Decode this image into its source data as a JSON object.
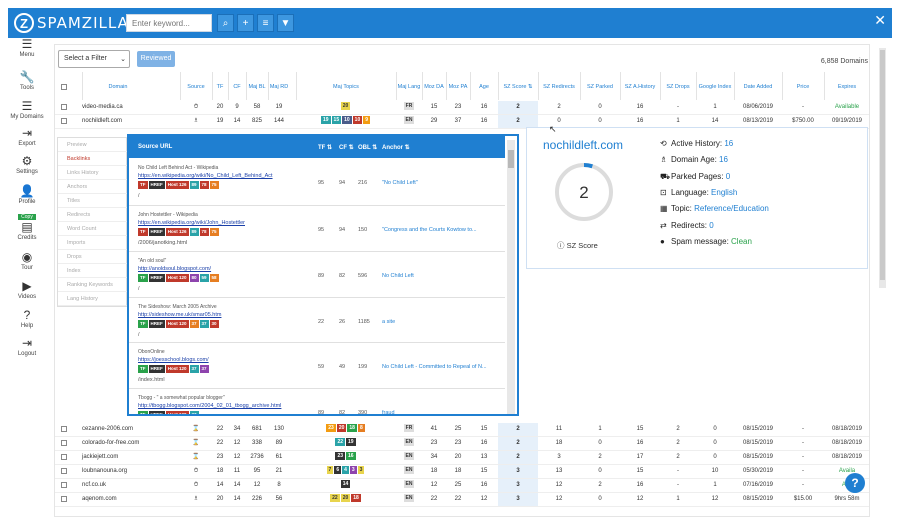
{
  "app": {
    "logo_letter": "Z",
    "logo_text": "SPAMZILLA"
  },
  "search": {
    "placeholder": "Enter keyword..."
  },
  "toolbar": {
    "search_icon": "search-icon",
    "add_icon": "plus-icon",
    "list_icon": "list-icon",
    "filter_icon": "filter-icon",
    "close": "✕"
  },
  "sidebar": [
    {
      "label": "Menu",
      "icon": "☰"
    },
    {
      "label": "Tools",
      "icon": "🔧"
    },
    {
      "label": "My Domains",
      "icon": "☰"
    },
    {
      "label": "Export",
      "icon": "⇥"
    },
    {
      "label": "Settings",
      "icon": "⚙"
    },
    {
      "label": "Profile",
      "icon": "👤"
    },
    {
      "label": "Credits",
      "icon": "▤",
      "badge": "Copy"
    },
    {
      "label": "Tour",
      "icon": "◉"
    },
    {
      "label": "Videos",
      "icon": "▶"
    },
    {
      "label": "Help",
      "icon": "?"
    },
    {
      "label": "Logout",
      "icon": "⇥"
    }
  ],
  "controls": {
    "filter_select": "Select a Filter",
    "reviewed_button": "Reviewed",
    "domains_count": "6,858 Domains"
  },
  "columns": [
    "Domain",
    "Source",
    "TF",
    "CF",
    "Maj BL",
    "Maj RD",
    "Maj Topics",
    "Maj Lang",
    "Moz DA",
    "Moz PA",
    "Age",
    "SZ Score ⇅",
    "SZ Redirects",
    "SZ Parked",
    "SZ A.History",
    "SZ Drops",
    "Google Index",
    "Date Added",
    "Price",
    "Expires"
  ],
  "rows_top": [
    {
      "domain": "video-media.ca",
      "source": "⏱",
      "tf": "20",
      "cf": "9",
      "bl": "58",
      "rd": "19",
      "topics": [
        {
          "v": "20",
          "c": "#e8d44d"
        }
      ],
      "lang": "FR",
      "da": "15",
      "pa": "23",
      "age": "16",
      "score": "2",
      "redir": "2",
      "parked": "0",
      "ahist": "16",
      "drops": "-",
      "gidx": "1",
      "date": "08/06/2019",
      "price": "-",
      "expires": "Available",
      "exp_color": "#2aa24b"
    },
    {
      "domain": "nochildleft.com",
      "source": "♗",
      "tf": "19",
      "cf": "14",
      "bl": "825",
      "rd": "144",
      "topics": [
        {
          "v": "19",
          "c": "#2aa3a8"
        },
        {
          "v": "15",
          "c": "#2aa3a8"
        },
        {
          "v": "10",
          "c": "#4a5c8a"
        },
        {
          "v": "10",
          "c": "#c0392b"
        },
        {
          "v": "9",
          "c": "#f39c12"
        }
      ],
      "lang": "EN",
      "da": "29",
      "pa": "37",
      "age": "16",
      "score": "2",
      "redir": "0",
      "parked": "0",
      "ahist": "16",
      "drops": "1",
      "gidx": "14",
      "date": "08/13/2019",
      "price": "$750.00",
      "expires": "09/19/2019",
      "exp_color": "#333"
    }
  ],
  "rows_bottom": [
    {
      "domain": "cezanne-2006.com",
      "source": "⌛",
      "tf": "22",
      "cf": "34",
      "bl": "681",
      "rd": "130",
      "topics": [
        {
          "v": "23",
          "c": "#f39c12"
        },
        {
          "v": "20",
          "c": "#c0392b"
        },
        {
          "v": "18",
          "c": "#2aa24b"
        },
        {
          "v": "8",
          "c": "#e67e22"
        }
      ],
      "lang": "FR",
      "da": "41",
      "pa": "25",
      "age": "15",
      "score": "2",
      "redir": "11",
      "parked": "1",
      "ahist": "15",
      "drops": "2",
      "gidx": "0",
      "date": "08/15/2019",
      "price": "-",
      "expires": "08/18/2019",
      "exp_color": "#333"
    },
    {
      "domain": "colorado-for-free.com",
      "source": "⌛",
      "tf": "22",
      "cf": "12",
      "bl": "338",
      "rd": "89",
      "topics": [
        {
          "v": "22",
          "c": "#2aa3a8"
        },
        {
          "v": "19",
          "c": "#333"
        }
      ],
      "lang": "EN",
      "da": "23",
      "pa": "23",
      "age": "16",
      "score": "2",
      "redir": "18",
      "parked": "0",
      "ahist": "16",
      "drops": "2",
      "gidx": "0",
      "date": "08/15/2019",
      "price": "-",
      "expires": "08/18/2019",
      "exp_color": "#333"
    },
    {
      "domain": "jackiejett.com",
      "source": "⌛",
      "tf": "23",
      "cf": "12",
      "bl": "2736",
      "rd": "61",
      "topics": [
        {
          "v": "23",
          "c": "#333"
        },
        {
          "v": "16",
          "c": "#2aa24b"
        }
      ],
      "lang": "EN",
      "da": "34",
      "pa": "20",
      "age": "13",
      "score": "2",
      "redir": "3",
      "parked": "2",
      "ahist": "17",
      "drops": "2",
      "gidx": "0",
      "date": "08/15/2019",
      "price": "-",
      "expires": "08/18/2019",
      "exp_color": "#333"
    },
    {
      "domain": "loubnanouna.org",
      "source": "⏱",
      "tf": "18",
      "cf": "11",
      "bl": "95",
      "rd": "21",
      "topics": [
        {
          "v": "7",
          "c": "#e8d44d"
        },
        {
          "v": "6",
          "c": "#333"
        },
        {
          "v": "4",
          "c": "#2aa3a8"
        },
        {
          "v": "3",
          "c": "#8e44ad"
        },
        {
          "v": "3",
          "c": "#e8d44d"
        }
      ],
      "lang": "EN",
      "da": "18",
      "pa": "18",
      "age": "15",
      "score": "3",
      "redir": "13",
      "parked": "0",
      "ahist": "15",
      "drops": "-",
      "gidx": "10",
      "date": "05/30/2019",
      "price": "-",
      "expires": "Availa",
      "exp_color": "#2aa24b"
    },
    {
      "domain": "ncf.co.uk",
      "source": "⏱",
      "tf": "14",
      "cf": "14",
      "bl": "12",
      "rd": "8",
      "topics": [
        {
          "v": "14",
          "c": "#333"
        }
      ],
      "lang": "EN",
      "da": "12",
      "pa": "25",
      "age": "16",
      "score": "3",
      "redir": "12",
      "parked": "2",
      "ahist": "16",
      "drops": "-",
      "gidx": "1",
      "date": "07/16/2019",
      "price": "-",
      "expires": "Ava",
      "exp_color": "#2aa24b"
    },
    {
      "domain": "aqenom.com",
      "source": "♗",
      "tf": "20",
      "cf": "14",
      "bl": "226",
      "rd": "56",
      "topics": [
        {
          "v": "22",
          "c": "#e8d44d"
        },
        {
          "v": "20",
          "c": "#e8d44d"
        },
        {
          "v": "18",
          "c": "#c0392b"
        }
      ],
      "lang": "EN",
      "da": "22",
      "pa": "22",
      "age": "12",
      "score": "3",
      "redir": "12",
      "parked": "0",
      "ahist": "12",
      "drops": "1",
      "gidx": "12",
      "date": "08/15/2019",
      "price": "$15.00",
      "expires": "9hrs 58m",
      "exp_color": "#333"
    }
  ],
  "side_menu": {
    "items": [
      "Preview",
      "Backlinks",
      "Links History",
      "Anchors",
      "Titles",
      "Redirects",
      "Word Count",
      "Imports",
      "Drops",
      "Index",
      "Ranking Keywords",
      "Lang History"
    ],
    "active": 1
  },
  "backlinks": {
    "headers": {
      "source": "Source URL",
      "tf": "TF ⇅",
      "cf": "CF ⇅",
      "obl": "OBL ⇅",
      "anchor": "Anchor ⇅"
    },
    "items": [
      {
        "title": "No Child Left Behind Act - Wikipedia",
        "url": "https://en.wikipedia.org/wiki/No_Child_Left_Behind_Act",
        "badges": [
          {
            "t": "TF",
            "c": "#c0392b"
          },
          {
            "t": "HREF",
            "c": "#333"
          },
          {
            "t": "Host 126",
            "c": "#c0392b"
          },
          {
            "t": "89",
            "c": "#2aa3a8"
          },
          {
            "t": "78",
            "c": "#c0392b"
          },
          {
            "t": "75",
            "c": "#e67e22"
          }
        ],
        "path": "/",
        "tf": "95",
        "cf": "94",
        "obl": "216",
        "anchor": "\"No Child Left\""
      },
      {
        "title": "John Hostettler - Wikipedia",
        "url": "https://en.wikipedia.org/wiki/John_Hostettler",
        "badges": [
          {
            "t": "TF",
            "c": "#c0392b"
          },
          {
            "t": "HREF",
            "c": "#333"
          },
          {
            "t": "Host 126",
            "c": "#c0392b"
          },
          {
            "t": "89",
            "c": "#2aa3a8"
          },
          {
            "t": "78",
            "c": "#c0392b"
          },
          {
            "t": "75",
            "c": "#e67e22"
          }
        ],
        "path": "/2006/janotking.html",
        "tf": "95",
        "cf": "94",
        "obl": "150",
        "anchor": "\"Congress and the Courts Kowtow to..."
      },
      {
        "title": "\"An old soul\"",
        "url": "http://anoldsoul.blogspot.com/",
        "badges": [
          {
            "t": "TF",
            "c": "#2aa24b"
          },
          {
            "t": "HREF",
            "c": "#333"
          },
          {
            "t": "Host 120",
            "c": "#c0392b"
          },
          {
            "t": "80",
            "c": "#8e44ad"
          },
          {
            "t": "59",
            "c": "#2aa3a8"
          },
          {
            "t": "58",
            "c": "#e67e22"
          }
        ],
        "path": "/",
        "tf": "89",
        "cf": "82",
        "obl": "596",
        "anchor": "No Child Left"
      },
      {
        "title": "The Sideshow: March 2005 Archive",
        "url": "http://sideshow.me.uk/smar05.htm",
        "badges": [
          {
            "t": "TF",
            "c": "#2aa24b"
          },
          {
            "t": "HREF",
            "c": "#333"
          },
          {
            "t": "Host 120",
            "c": "#c0392b"
          },
          {
            "t": "37",
            "c": "#e67e22"
          },
          {
            "t": "37",
            "c": "#2aa3a8"
          },
          {
            "t": "30",
            "c": "#c0392b"
          }
        ],
        "path": "/",
        "tf": "22",
        "cf": "26",
        "obl": "1185",
        "anchor": "a site"
      },
      {
        "title": "ObonOnline",
        "url": "https://joesschool.blogs.com/",
        "badges": [
          {
            "t": "TF",
            "c": "#2aa24b"
          },
          {
            "t": "HREF",
            "c": "#333"
          },
          {
            "t": "Host 120",
            "c": "#c0392b"
          },
          {
            "t": "37",
            "c": "#2aa3a8"
          },
          {
            "t": "37",
            "c": "#8e44ad"
          }
        ],
        "path": "/index.html",
        "tf": "59",
        "cf": "49",
        "obl": "199",
        "anchor": "No Child Left - Committed to Repeal of N..."
      },
      {
        "title": "Tbogg - \" a somewhat popular blogger\"",
        "url": "http://tbogg.blogspot.com/2004_02_01_tbogg_archive.html",
        "badges": [
          {
            "t": "TF",
            "c": "#2aa24b"
          },
          {
            "t": "HREF",
            "c": "#333"
          },
          {
            "t": "Host 120",
            "c": "#c0392b"
          },
          {
            "t": "37",
            "c": "#2aa3a8"
          }
        ],
        "path": "",
        "tf": "89",
        "cf": "82",
        "obl": "390",
        "anchor": "fraud"
      }
    ]
  },
  "info": {
    "domain": "nochildleft.com",
    "score": "2",
    "score_fraction": 0.05,
    "score_label": "SZ Score",
    "facts": [
      {
        "icon": "⟲",
        "label": "Active History: ",
        "value": "16",
        "green": false
      },
      {
        "icon": "♗",
        "label": "Domain Age: ",
        "value": "16",
        "green": false
      },
      {
        "icon": "⛟",
        "label": "Parked Pages: ",
        "value": "0",
        "green": false
      },
      {
        "icon": "⊡",
        "label": "Language: ",
        "value": "English",
        "green": false
      },
      {
        "icon": "▦",
        "label": "Topic: ",
        "value": "Reference/Education",
        "green": false
      },
      {
        "icon": "⇄",
        "label": "Redirects: ",
        "value": "0",
        "green": false
      },
      {
        "icon": "●",
        "label": "Spam message: ",
        "value": "Clean",
        "green": true
      }
    ],
    "accent": "#1f7fd1"
  },
  "help_button": "?"
}
